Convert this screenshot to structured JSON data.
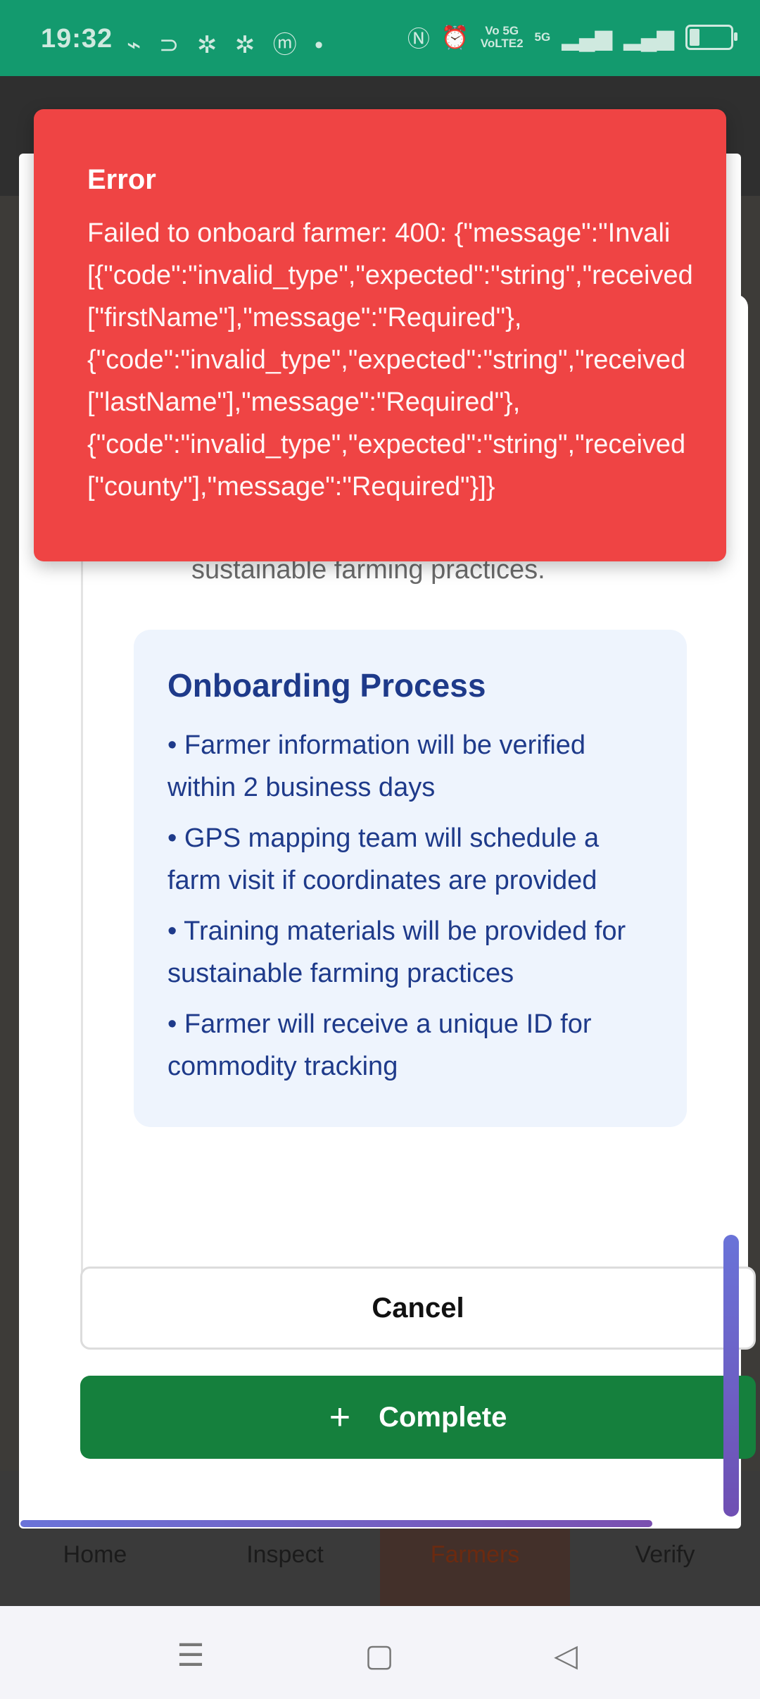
{
  "status_bar": {
    "time": "19:32",
    "left_icons": "⌁ ⊃ ✲ ✲ ⓜ •",
    "volte_top": "Vo 5G",
    "volte_bottom": "VoLTE2",
    "network": "5G"
  },
  "bottom_nav": {
    "items": [
      {
        "label": "Home"
      },
      {
        "label": "Inspect"
      },
      {
        "label": "Farmers"
      },
      {
        "label": "Verify"
      }
    ]
  },
  "modal": {
    "card_tail_text": "sustainable farming practices.",
    "process": {
      "title": "Onboarding Process",
      "items": [
        "• Farmer information will be verified within 2 business days",
        "• GPS mapping team will schedule a farm visit if coordinates are provided",
        "• Training materials will be provided for sustainable farming practices",
        "• Farmer will receive a unique ID for commodity tracking"
      ]
    },
    "cancel_label": "Cancel",
    "complete_label": "Complete"
  },
  "toast": {
    "title": "Error",
    "message": "Failed to onboard farmer: 400: {\"message\":\"Invali\n[{\"code\":\"invalid_type\",\"expected\":\"string\",\"received\n[\"firstName\"],\"message\":\"Required\"},\n{\"code\":\"invalid_type\",\"expected\":\"string\",\"received\n[\"lastName\"],\"message\":\"Required\"},\n{\"code\":\"invalid_type\",\"expected\":\"string\",\"received\n[\"county\"],\"message\":\"Required\"}]}"
  },
  "colors": {
    "status_bar": "#139a6e",
    "toast": "#ef4444",
    "complete_button": "#15803d",
    "process_text": "#1e3a8a"
  }
}
